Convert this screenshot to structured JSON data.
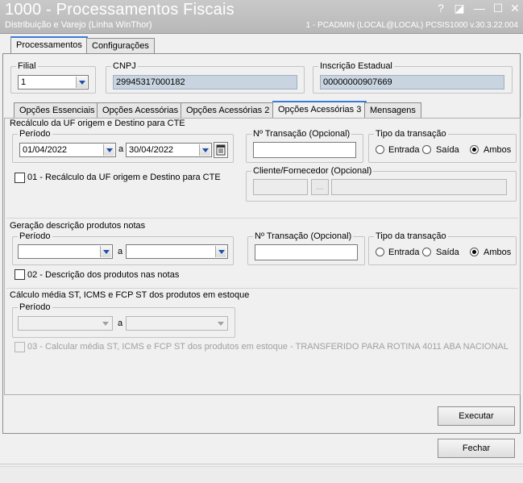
{
  "window": {
    "title": "1000 - Processamentos Fiscais",
    "subtitle": "Distribuição e Varejo (Linha WinThor)",
    "user_info": "1 - PCADMIN (LOCAL@LOCAL)   PCSIS1000  v.30.3.22.004",
    "help_glyph": "?",
    "restore_glyph": "◪",
    "minimize_glyph": "—",
    "maximize_glyph": "☐",
    "close_glyph": "✕"
  },
  "main_tabs": [
    {
      "label": "Processamentos",
      "active": true
    },
    {
      "label": "Configurações",
      "active": false
    }
  ],
  "header": {
    "filial_label": "Filial",
    "filial_value": "1",
    "cnpj_label": "CNPJ",
    "cnpj_value": "29945317000182",
    "ie_label": "Inscrição Estadual",
    "ie_value": "00000000907669"
  },
  "sub_tabs": [
    {
      "label": "Opções Essenciais",
      "active": false
    },
    {
      "label": "Opções Acessórias",
      "active": false
    },
    {
      "label": "Opções Acessórias 2",
      "active": false
    },
    {
      "label": "Opções Acessórias 3",
      "active": true
    },
    {
      "label": "Mensagens",
      "active": false
    }
  ],
  "section1": {
    "title": "Recálculo da UF origem e Destino para CTE",
    "periodo_label": "Período",
    "date_from": "01/04/2022",
    "separator": "a",
    "date_to": "30/04/2022",
    "transacao_label": "Nº Transação (Opcional)",
    "tipo_label": "Tipo da transação",
    "radio_entrada": "Entrada",
    "radio_saida": "Saída",
    "radio_ambos": "Ambos",
    "selected": "Ambos",
    "checkbox_label": "01 - Recálculo da UF origem e Destino para CTE",
    "cliente_label": "Cliente/Fornecedor (Opcional)",
    "lookup_button": "..."
  },
  "section2": {
    "title": "Geração descrição produtos notas",
    "periodo_label": "Período",
    "separator": "a",
    "transacao_label": "Nº Transação (Opcional)",
    "tipo_label": "Tipo da transação",
    "radio_entrada": "Entrada",
    "radio_saida": "Saída",
    "radio_ambos": "Ambos",
    "selected": "Ambos",
    "checkbox_label": "02 - Descrição dos produtos nas notas"
  },
  "section3": {
    "title": "Cálculo média ST, ICMS e FCP ST dos produtos em estoque",
    "periodo_label": "Período",
    "separator": "a",
    "checkbox_label": "03 - Calcular média ST, ICMS e FCP ST dos produtos em estoque - TRANSFERIDO PARA ROTINA 4011 ABA NACIONAL"
  },
  "buttons": {
    "executar": "Executar",
    "fechar": "Fechar"
  }
}
